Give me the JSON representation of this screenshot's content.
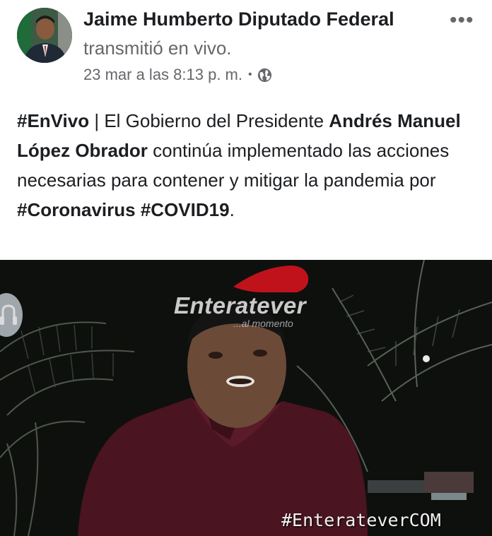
{
  "post": {
    "author": "Jaime Humberto Diputado Federal",
    "action": "transmitió en vivo.",
    "timestamp": "23 mar a las 8:13 p. m.",
    "separator": "•",
    "more_icon": "more-icon",
    "privacy_icon": "globe-icon"
  },
  "body": {
    "hashtag_live": "#EnVivo",
    "seg1": " | El Gobierno del Presidente ",
    "name": "Andrés Manuel López Obrador",
    "seg2": " continúa implementado las acciones necesarias para contener y mitigar la pandemia por ",
    "hashtag_corona": "#Coronavirus",
    "seg3": " ",
    "hashtag_covid": "#COVID19",
    "seg4": "."
  },
  "video": {
    "watermark": "Enteratever",
    "watermark_sub": "...al momento",
    "bottom_tag": "#EnterateverCOM",
    "audio_icon": "audio-icon"
  },
  "colors": {
    "text": "#1c1e21",
    "secondary": "#65676b",
    "logo_red": "#c0121b"
  }
}
